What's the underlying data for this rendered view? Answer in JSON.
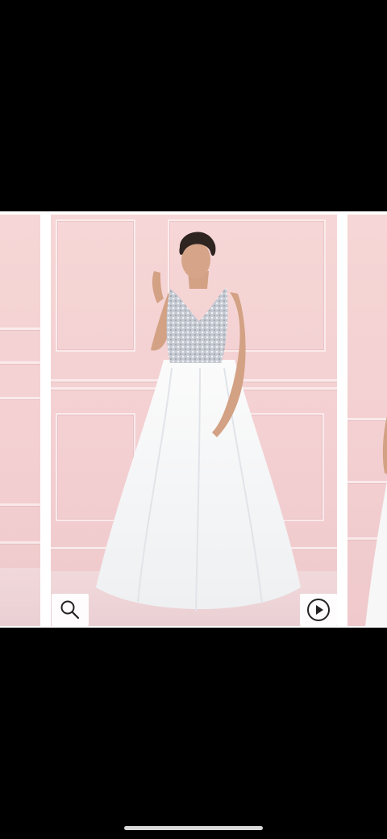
{
  "gallery": {
    "slides": [
      {
        "icon": "dress-photo-previous"
      },
      {
        "icon": "dress-photo-current"
      },
      {
        "icon": "dress-photo-next"
      }
    ],
    "controls": {
      "zoom_icon": "magnifier-icon",
      "play_icon": "play-circle-icon"
    }
  },
  "colors": {
    "background": "#000000",
    "wall": "#f6d6d6",
    "dress": "#ffffff",
    "bodice": "#c9ccd3",
    "home_indicator": "#d9d9d9"
  }
}
